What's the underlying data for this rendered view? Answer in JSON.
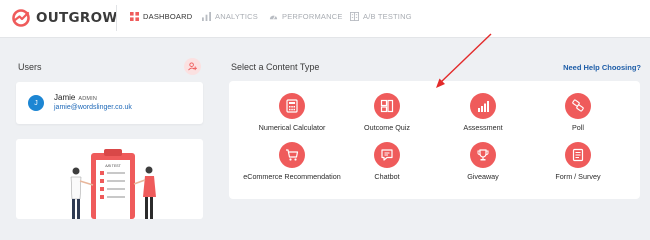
{
  "brand": {
    "name": "OUTGROW",
    "accent": "#ef5b5b"
  },
  "nav": {
    "items": [
      {
        "label": "DASHBOARD",
        "icon": "dashboard-icon",
        "active": true
      },
      {
        "label": "ANALYTICS",
        "icon": "analytics-icon",
        "active": false
      },
      {
        "label": "PERFORMANCE",
        "icon": "performance-icon",
        "active": false
      },
      {
        "label": "A/B TESTING",
        "icon": "ab-testing-icon",
        "active": false
      }
    ]
  },
  "users": {
    "title": "Users",
    "add_icon": "add-user-icon",
    "list": [
      {
        "initial": "J",
        "name": "Jamie",
        "role": "ADMIN",
        "email": "jamie@wordslinger.co.uk"
      }
    ]
  },
  "content_types": {
    "title": "Select a Content Type",
    "help_link": "Need Help Choosing?",
    "items": [
      {
        "label": "Numerical Calculator",
        "icon": "calculator-icon"
      },
      {
        "label": "Outcome Quiz",
        "icon": "quiz-icon"
      },
      {
        "label": "Assessment",
        "icon": "assessment-icon"
      },
      {
        "label": "Poll",
        "icon": "poll-icon"
      },
      {
        "label": "eCommerce Recommendation",
        "icon": "cart-icon"
      },
      {
        "label": "Chatbot",
        "icon": "chatbot-icon"
      },
      {
        "label": "Giveaway",
        "icon": "trophy-icon"
      },
      {
        "label": "Form / Survey",
        "icon": "form-icon"
      }
    ]
  },
  "illustration": {
    "caption": "A/B TEST"
  }
}
